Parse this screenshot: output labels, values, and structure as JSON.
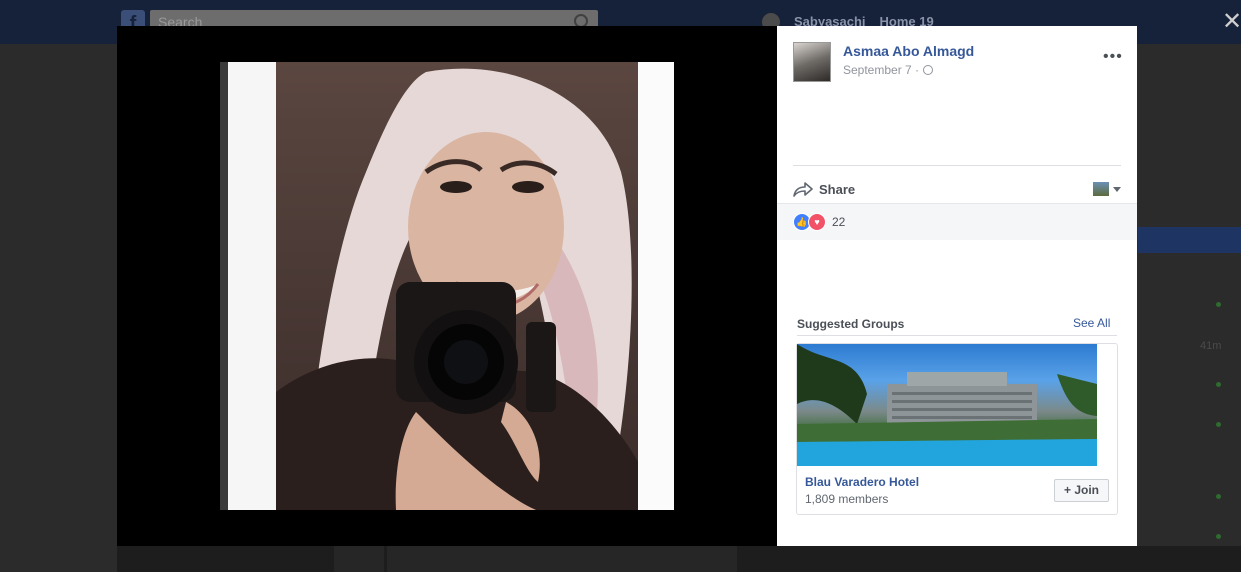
{
  "background": {
    "search_placeholder": "Search",
    "user_name": "Sabyasachi",
    "home_label": "Home",
    "home_count": "19",
    "right_time": "41m"
  },
  "modal": {
    "close_label": "✕"
  },
  "post": {
    "author": "Asmaa Abo Almagd",
    "date": "September 7 ·",
    "more_label": "•••",
    "share_label": "Share",
    "reaction_count": "22"
  },
  "suggested_groups": {
    "title": "Suggested Groups",
    "see_all": "See All",
    "group": {
      "name": "Blau Varadero Hotel",
      "members": "1,809 members",
      "join_label": "+ Join"
    }
  },
  "colors": {
    "link_blue": "#365899",
    "like_blue": "#4080ff",
    "love_red": "#f25268"
  }
}
